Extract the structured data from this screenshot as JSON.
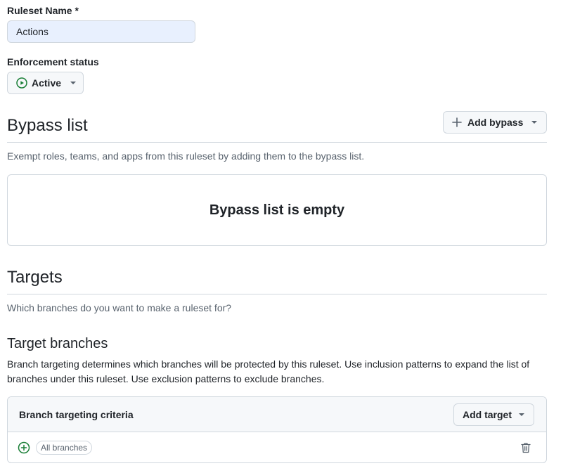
{
  "ruleset_name": {
    "label": "Ruleset Name *",
    "value": "Actions"
  },
  "enforcement": {
    "label": "Enforcement status",
    "value": "Active",
    "icon": "play-circle-icon",
    "icon_color": "#1a7f37"
  },
  "bypass": {
    "title": "Bypass list",
    "add_button": "Add bypass",
    "description": "Exempt roles, teams, and apps from this ruleset by adding them to the bypass list.",
    "empty_text": "Bypass list is empty"
  },
  "targets": {
    "title": "Targets",
    "description": "Which branches do you want to make a ruleset for?",
    "branches_title": "Target branches",
    "branches_description": "Branch targeting determines which branches will be protected by this ruleset. Use inclusion patterns to expand the list of branches under this ruleset. Use exclusion patterns to exclude branches.",
    "criteria_title": "Branch targeting criteria",
    "add_target": "Add target",
    "criteria_items": [
      {
        "label": "All branches",
        "icon": "plus-circle-icon"
      }
    ]
  },
  "colors": {
    "accent_green": "#1a7f37",
    "border": "#d0d7de",
    "muted_text": "#59636e",
    "input_bg": "#e8f0fe"
  }
}
